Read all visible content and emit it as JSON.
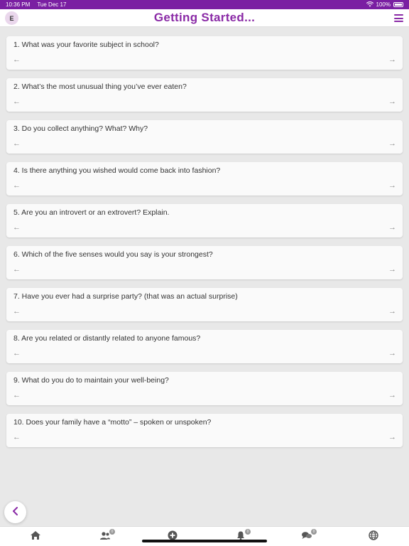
{
  "status_bar": {
    "time": "10:36 PM",
    "date": "Tue Dec 17",
    "battery": "100%"
  },
  "header": {
    "avatar_initial": "E",
    "title": "Getting Started...",
    "menu_icon": "hamburger-icon"
  },
  "questions": [
    "1. What was your favorite subject in school?",
    "2. What’s the most unusual thing you’ve ever eaten?",
    "3. Do you collect anything? What? Why?",
    "4. Is there anything you wished would come back into fashion?",
    "5. Are you an introvert or an extrovert? Explain.",
    "6. Which of the five senses would you say is your strongest?",
    "7. Have you ever had a surprise party? (that was an actual surprise)",
    "8. Are you related or distantly related to anyone famous?",
    "9. What do you do to maintain your well-being?",
    "10. Does your family have a “motto” – spoken or unspoken?"
  ],
  "tabbar": {
    "tabs": [
      {
        "icon": "home-icon"
      },
      {
        "icon": "users-icon",
        "badge": "0"
      },
      {
        "icon": "add-circle-icon"
      },
      {
        "icon": "bell-icon",
        "badge": "0"
      },
      {
        "icon": "chat-icon",
        "badge": "0"
      },
      {
        "icon": "globe-icon"
      }
    ]
  },
  "colors": {
    "accent": "#8a2aa6",
    "status_bar": "#7a1fa2",
    "background": "#e8e8e8",
    "card": "#fafafa"
  }
}
